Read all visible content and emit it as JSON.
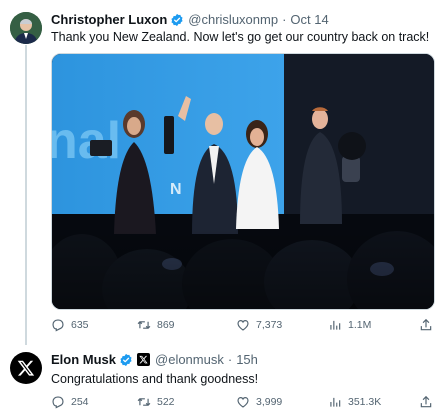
{
  "tweets": [
    {
      "name": "Christopher Luxon",
      "handle": "@chrisluxonmp",
      "separator": "·",
      "time": "Oct 14",
      "text": "Thank you New Zealand. Now let's go get our country back on track!",
      "media_sign": "nal",
      "media_sign2": "N",
      "metrics": {
        "replies": "635",
        "retweets": "869",
        "likes": "7,373",
        "views": "1.1M"
      }
    },
    {
      "name": "Elon Musk",
      "handle": "@elonmusk",
      "separator": "·",
      "time": "15h",
      "text": "Congratulations and thank goodness!",
      "metrics": {
        "replies": "254",
        "retweets": "522",
        "likes": "3,999",
        "views": "351.3K"
      }
    }
  ],
  "colors": {
    "verified": "#1d9bf0",
    "muted": "#536471",
    "thread_line": "#cfd9de",
    "stage_blue": "#2e8fd9"
  },
  "icons": [
    "reply-icon",
    "retweet-icon",
    "like-icon",
    "views-icon",
    "share-icon",
    "verified-badge-icon",
    "x-logo-icon"
  ]
}
